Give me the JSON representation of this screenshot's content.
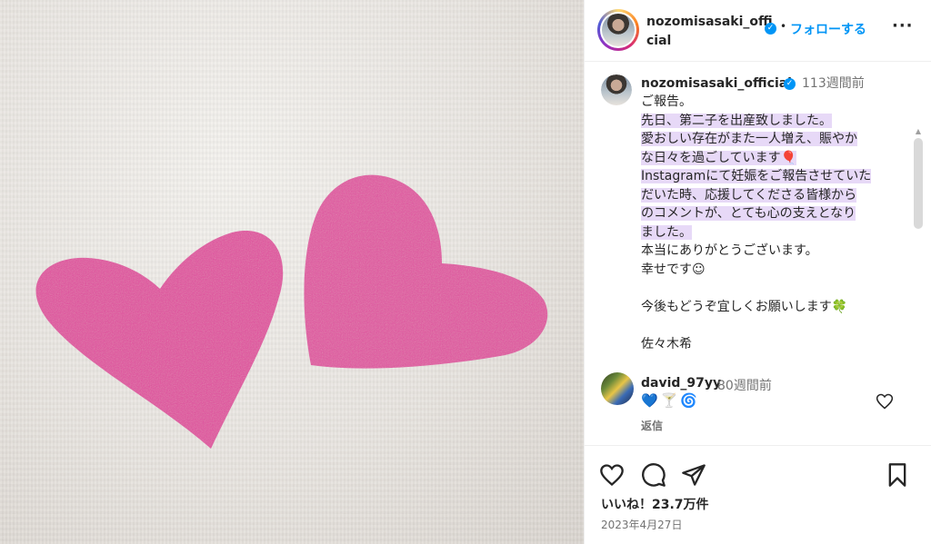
{
  "header": {
    "username": "nozomisasaki_official",
    "verified_mark": "✓",
    "separator": "•",
    "follow_label": "フォローする",
    "more_label": "···"
  },
  "caption": {
    "username": "nozomisasaki_official",
    "verified_mark": "✓",
    "time": "113週間前",
    "line0": "ご報告。",
    "highlighted": "先日、第二子を出産致しました。\n愛おしい存在がまた一人増え、賑やか\nな日々を過ごしています🎈\nInstagramにて妊娠をご報告させていた\nだいた時、応援してくださる皆様から\nのコメントが、とても心の支えとなり\nました。",
    "rest": "\n本当にありがとうございます。\n幸せです☺\n\n今後もどうぞ宜しくお願いします🍀\n\n佐々木希"
  },
  "comment": {
    "username": "david_97yy",
    "time": "80週間前",
    "text": "💙🍸🌀",
    "reply_label": "返信"
  },
  "footer": {
    "likes": "いいね！23.7万件",
    "date": "2023年4月27日"
  },
  "colors": {
    "accent": "#0095f6",
    "highlight": "#e7d9f7",
    "heart_pink": "#e0358a"
  },
  "icons": [
    "heart-icon",
    "comment-icon",
    "share-icon",
    "bookmark-icon",
    "more-icon",
    "verified-icon"
  ]
}
